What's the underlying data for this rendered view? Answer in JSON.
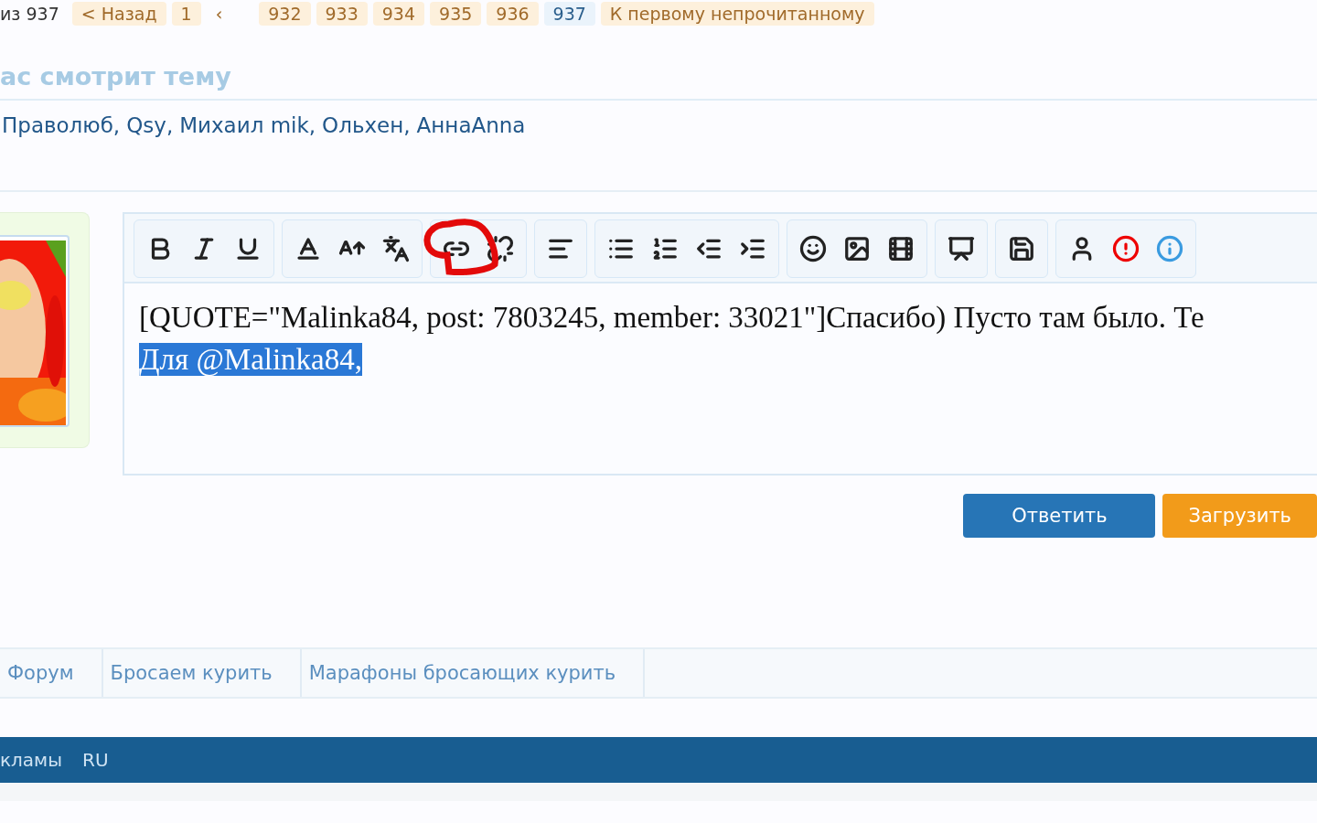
{
  "pagination": {
    "prefix": "из 937",
    "pages": [
      {
        "label": "< Назад",
        "selected": false
      },
      {
        "label": "1",
        "selected": false
      },
      {
        "label": "‹",
        "selected": false,
        "kind": "plain"
      },
      {
        "label": "932",
        "selected": false
      },
      {
        "label": "933",
        "selected": false
      },
      {
        "label": "934",
        "selected": false
      },
      {
        "label": "935",
        "selected": false
      },
      {
        "label": "936",
        "selected": false
      },
      {
        "label": "937",
        "selected": true
      },
      {
        "label": "К первому непрочитанному",
        "selected": false
      }
    ]
  },
  "viewers": {
    "title": "ас смотрит тему",
    "users": [
      "Праволюб,",
      "Qsy,",
      "Михаил mik,",
      "Ольхен,",
      "АннаAnna"
    ]
  },
  "editor": {
    "lines": [
      {
        "text": "[QUOTE=\"Malinka84, post: 7803245, member: 33021\"]Спасибо) Пусто там было. Те",
        "selected": false
      },
      {
        "text": "Для  @Malinka84,",
        "selected": true
      }
    ],
    "buttons": [
      {
        "label": "Ответить",
        "kind": "primary"
      },
      {
        "label": "Загрузить",
        "kind": "upload"
      }
    ]
  },
  "breadcrumbs": [
    "Форум",
    "Бросаем курить",
    "Марафоны бросающих курить"
  ],
  "footer": {
    "links": [
      "кламы",
      "RU"
    ]
  }
}
